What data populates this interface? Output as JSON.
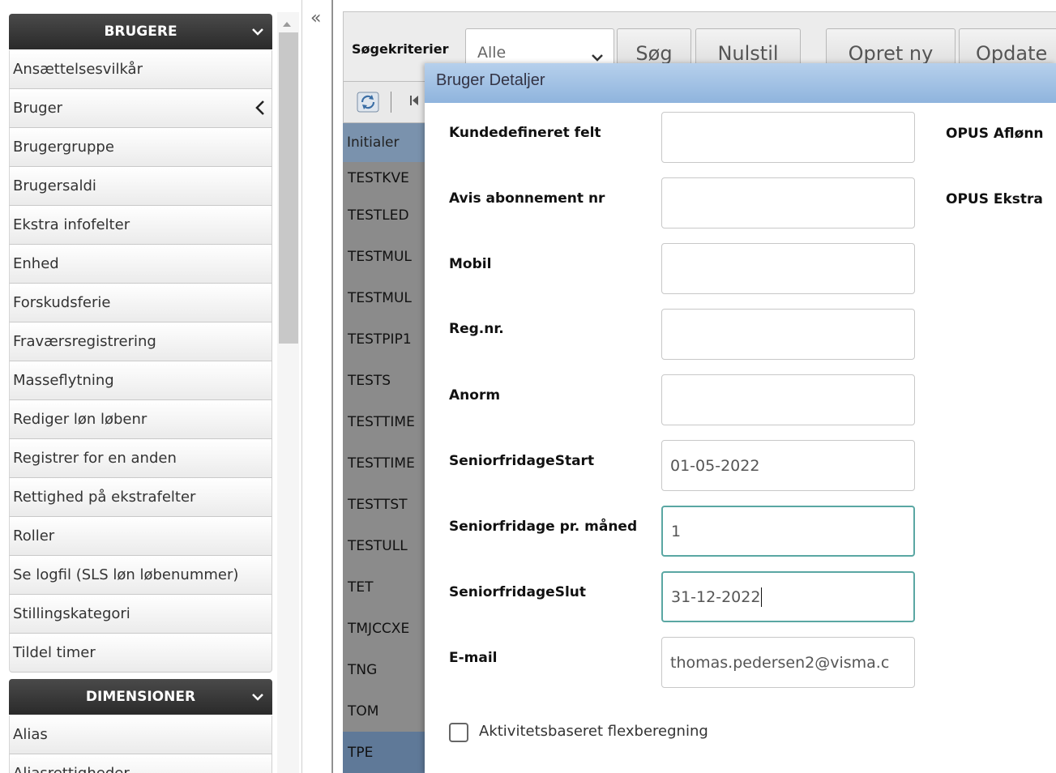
{
  "sidebar": {
    "sections": [
      {
        "title": "BRUGERE"
      },
      {
        "title": "DIMENSIONER"
      }
    ],
    "brugere_items": [
      "Ansættelsesvilkår",
      "Bruger",
      "Brugergruppe",
      "Brugersaldi",
      "Ekstra infofelter",
      "Enhed",
      "Forskudsferie",
      "Fraværsregistrering",
      "Masseflytning",
      "Rediger løn løbenr",
      "Registrer for en anden",
      "Rettighed på ekstrafelter",
      "Roller",
      "Se logfil (SLS løn løbenummer)",
      "Stillingskategori",
      "Tildel timer"
    ],
    "active_item": "Bruger",
    "dimensioner_items": [
      "Alias",
      "Aliasrettigheder"
    ]
  },
  "collapse_glyph": "«",
  "toolbar": {
    "criteria_label": "Søgekriterier",
    "criteria_value": "Alle",
    "search_button": "Søg",
    "reset_button": "Nulstil",
    "create_button": "Opret ny",
    "update_button": "Opdate"
  },
  "grid": {
    "header": "Initialer",
    "rows": [
      "TESTKVE",
      "TESTLED",
      "TESTMUL",
      "TESTMUL",
      "TESTPIP1",
      "TESTS",
      "TESTTIME",
      "TESTTIME",
      "TESTTST",
      "TESTULL",
      "TET",
      "TMJCCXE",
      "TNG",
      "TOM",
      "TPE"
    ],
    "selected_row": "TPE"
  },
  "dialog": {
    "title": "Bruger Detaljer",
    "fields": [
      {
        "label": "Kundedefineret felt",
        "value": ""
      },
      {
        "label": "Avis abonnement nr",
        "value": ""
      },
      {
        "label": "Mobil",
        "value": ""
      },
      {
        "label": "Reg.nr.",
        "value": ""
      },
      {
        "label": "Anorm",
        "value": ""
      },
      {
        "label": "SeniorfridageStart",
        "value": "01-05-2022"
      },
      {
        "label": "Seniorfridage pr. måned",
        "value": "1"
      },
      {
        "label": "SeniorfridageSlut",
        "value": "31-12-2022"
      },
      {
        "label": "E-mail",
        "value": "thomas.pedersen2@visma.c"
      }
    ],
    "right_labels": [
      "OPUS Aflønn",
      "OPUS Ekstra"
    ],
    "checkbox_label": "Aktivitetsbaseret flexberegning",
    "checkbox_checked": false
  },
  "colors": {
    "sidebar_header": "#333333",
    "dialog_title_bg": "#9dbde2",
    "grid_header": "#7a92ad",
    "grid_selected": "#5f7998",
    "focus_border": "#5aa7a3"
  }
}
